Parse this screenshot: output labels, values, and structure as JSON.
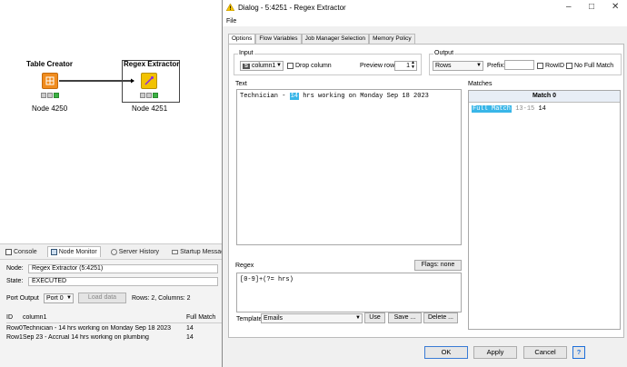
{
  "workflow": {
    "nodes": [
      {
        "title": "Table Creator",
        "label": "Node 4250"
      },
      {
        "title": "Regex Extractor",
        "label": "Node 4251"
      }
    ]
  },
  "monitor": {
    "tabs": [
      "Console",
      "Node Monitor",
      "Server History",
      "Startup Messages"
    ],
    "node_label": "Node:",
    "node_value": "Regex Extractor  (5:4251)",
    "state_label": "State:",
    "state_value": "EXECUTED",
    "port_output_label": "Port Output",
    "port_value": "Port 0",
    "load_button": "Load data",
    "rows_info": "Rows: 2, Columns: 2",
    "table": {
      "headers": [
        "ID",
        "column1",
        "Full Match"
      ],
      "rows": [
        [
          "Row0",
          "Technician - 14 hrs working on Monday Sep 18 2023",
          "14"
        ],
        [
          "Row1",
          "Sep 23 - Accrual 14 hrs working on plumbing",
          "14"
        ]
      ]
    }
  },
  "dialog": {
    "title": "Dialog - 5:4251 - Regex Extractor",
    "menu": "File",
    "tabs": [
      "Options",
      "Flow Variables",
      "Job Manager Selection",
      "Memory Policy"
    ],
    "input": {
      "legend": "Input",
      "column_badge": "S",
      "column": "column1",
      "drop_column": "Drop column",
      "preview_row_label": "Preview row:",
      "preview_row": "1"
    },
    "output": {
      "legend": "Output",
      "mode": "Rows",
      "prefix_label": "Prefix:",
      "rowid_label": "RowID",
      "no_full_match_label": "No Full Match"
    },
    "text": {
      "legend": "Text",
      "before": "Technician - ",
      "match": "14",
      "after": " hrs working on Monday Sep 18 2023"
    },
    "matches": {
      "legend": "Matches",
      "header": "Match 0",
      "group_name": "Full Match",
      "range": "13-15",
      "value": "14"
    },
    "regex": {
      "legend": "Regex",
      "flags_button": "Flags: none",
      "pattern": "[0-9]+(?= hrs)"
    },
    "template": {
      "label": "Template",
      "value": "Emails",
      "use": "Use",
      "save": "Save ...",
      "delete": "Delete ..."
    },
    "buttons": {
      "ok": "OK",
      "apply": "Apply",
      "cancel": "Cancel",
      "help": "?"
    }
  },
  "colors": {
    "match_highlight": "#39b6e8",
    "node_executed": "#3cb043",
    "extractor_icon": "#f2c200",
    "creator_icon": "#f08c1e"
  }
}
